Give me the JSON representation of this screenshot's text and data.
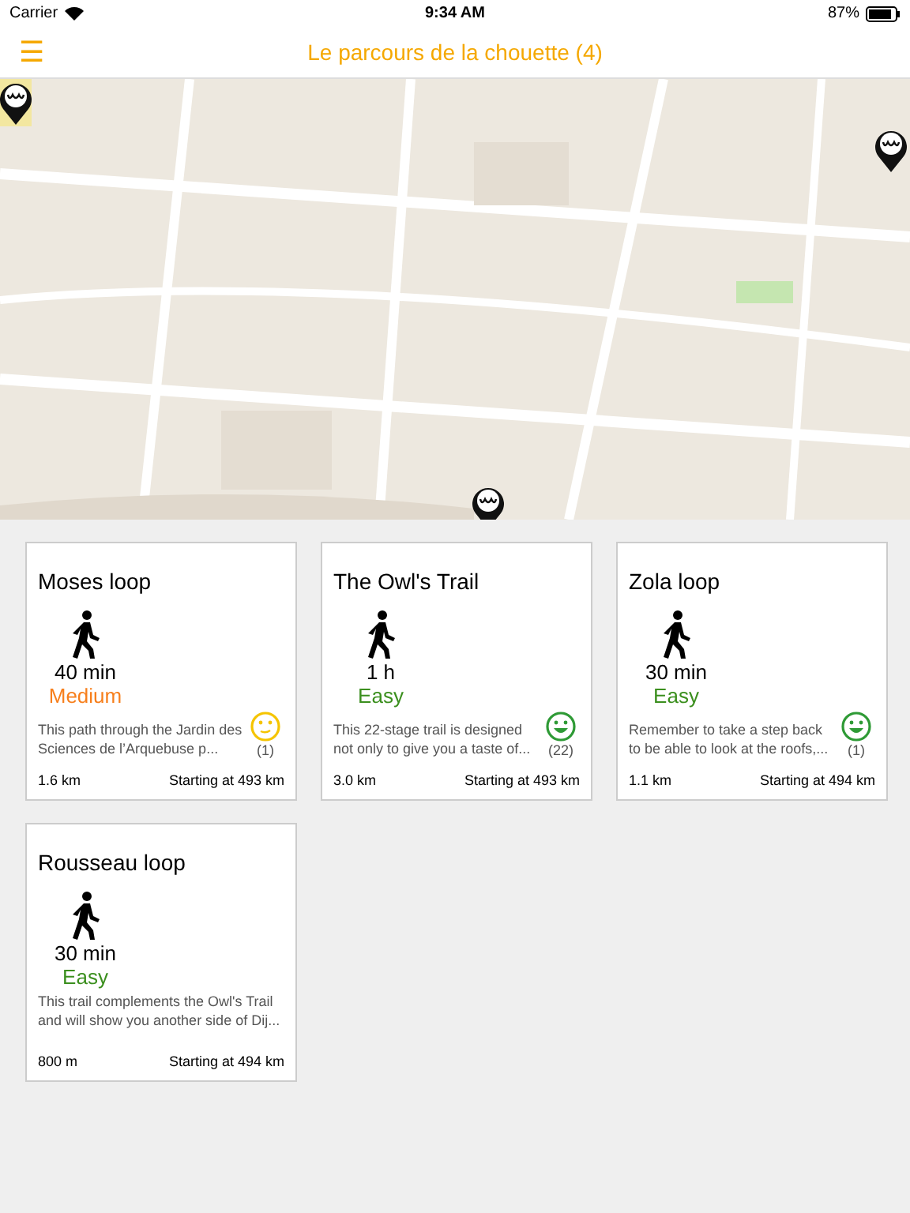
{
  "status_bar": {
    "carrier": "Carrier",
    "time": "9:34 AM",
    "battery": "87%"
  },
  "nav": {
    "menu": "☰",
    "title": "Le parcours de la chouette (4)"
  },
  "trails": [
    {
      "name": "Moses loop",
      "duration": "40 min",
      "difficulty": {
        "label": "Medium",
        "color": "#f77f1c"
      },
      "description": "This path through the Jardin des Sciences de l’Arquebuse p...",
      "rating": {
        "kind": "neutral",
        "color": "#f5c400",
        "count": "(1)"
      },
      "distance": "1.6 km",
      "start": "Starting at 493 km"
    },
    {
      "name": "The Owl's Trail",
      "duration": "1 h",
      "difficulty": {
        "label": "Easy",
        "color": "#3b8f1e"
      },
      "description": "This 22-stage trail is designed not only to give you a taste of...",
      "rating": {
        "kind": "happy",
        "color": "#2e9a35",
        "count": "(22)"
      },
      "distance": "3.0 km",
      "start": "Starting at 493 km"
    },
    {
      "name": "Zola loop",
      "duration": "30 min",
      "difficulty": {
        "label": "Easy",
        "color": "#3b8f1e"
      },
      "description": "Remember to take a step back to be able to look at the roofs,...",
      "rating": {
        "kind": "happy",
        "color": "#2e9a35",
        "count": "(1)"
      },
      "distance": "1.1 km",
      "start": "Starting at 494 km"
    },
    {
      "name": "Rousseau loop",
      "duration": "30 min",
      "difficulty": {
        "label": "Easy",
        "color": "#3b8f1e"
      },
      "description": "This trail complements the Owl's Trail and will show you another side of Dij...",
      "distance": "800 m",
      "start": "Starting at 494 km"
    }
  ]
}
